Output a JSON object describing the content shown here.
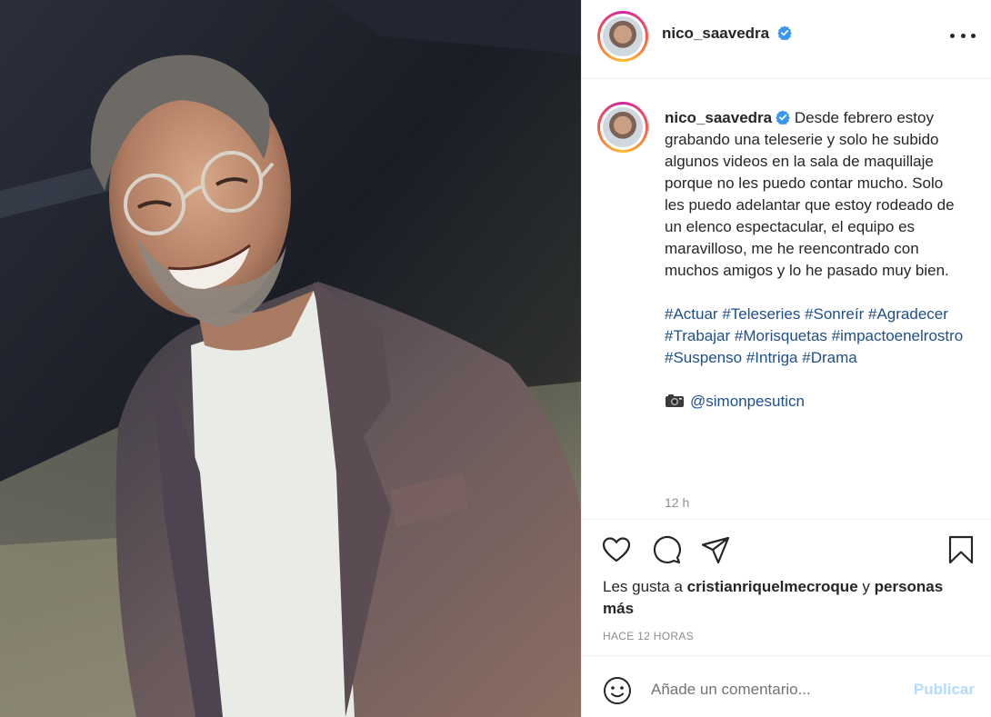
{
  "post": {
    "username": "nico_saavedra",
    "more_label": "Más opciones",
    "caption": "Desde febrero estoy grabando una teleserie y solo he subido algunos videos en la sala de maquillaje porque no les puedo contar mucho. Solo les puedo adelantar que estoy rodeado de un elenco espectacular, el equipo es maravilloso, me he reencontrado con muchos amigos y lo he pasado muy bien.",
    "hashtags": [
      "#Actuar",
      "#Teleseries",
      "#Sonreír",
      "#Agradecer",
      "#Trabajar",
      "#Morisquetas",
      "#impactoenelrostro",
      "#Suspenso",
      "#Intriga",
      "#Drama"
    ],
    "mention": "@simonpesuticn",
    "caption_time": "12 h",
    "likes_prefix": "Les gusta a",
    "likes_user": "cristianriquelmecroque",
    "likes_and": "y",
    "likes_others": "personas más",
    "timestamp": "HACE 12 HORAS"
  },
  "icons": {
    "verified": "verified-badge-icon",
    "like": "heart-icon",
    "comment": "comment-bubble-icon",
    "share": "paper-plane-icon",
    "save": "bookmark-icon",
    "emoji": "smiley-icon",
    "camera": "camera-emoji"
  },
  "comment": {
    "placeholder": "Añade un comentario...",
    "publish_label": "Publicar"
  },
  "colors": {
    "link": "#1e4f8a",
    "verified": "#3897f0",
    "publish_disabled": "#b3dbff",
    "muted": "#8e8e8e"
  }
}
